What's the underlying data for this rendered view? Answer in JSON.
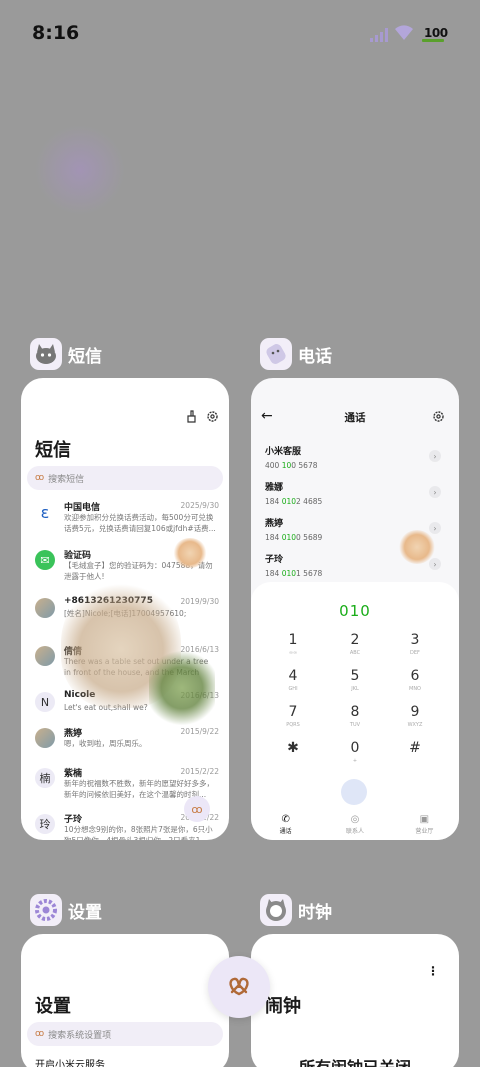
{
  "status_bar": {
    "time": "8:16",
    "battery": "100"
  },
  "apps": [
    {
      "title": "短信",
      "icon": "cat-icon"
    },
    {
      "title": "电话",
      "icon": "bandage-cat-icon"
    },
    {
      "title": "设置",
      "icon": "settings-flower-icon"
    },
    {
      "title": "时钟",
      "icon": "clock-cat-icon"
    }
  ],
  "sms": {
    "title": "短信",
    "search_placeholder": "搜索短信",
    "messages": [
      {
        "name": "中国电信",
        "date": "2025/9/30",
        "avatar": "telecom-icon",
        "body": "欢迎参加积分兑换话费活动，每500分可兑换话费5元，兑换话费请回复106或jfdh#话费..."
      },
      {
        "name": "验证码",
        "date": "",
        "avatar": "message-icon",
        "body": "【毛绒盒子】您的验证码为：047588，请勿泄露于他人!"
      },
      {
        "name": "+8613261230775",
        "date": "2019/9/30",
        "avatar": "photo-avatar",
        "body": "[姓名]Nicole;[电话]17004957610;"
      },
      {
        "name": "倩倩",
        "date": "2016/6/13",
        "avatar": "photo-avatar",
        "body": "There was a table set out under a tree in front of the house, and the March Hare an..."
      },
      {
        "name": "Nicole",
        "date": "2016/6/13",
        "avatar": "N",
        "body": "Let's eat out,shall we?"
      },
      {
        "name": "燕婷",
        "date": "2015/9/22",
        "avatar": "photo-avatar",
        "body": "嗯，收到啦，周乐周乐。"
      },
      {
        "name": "紫楠",
        "date": "2015/2/22",
        "avatar": "楠",
        "body": "新年的祝福数不胜数，新年的愿望好好多多，新年的问候依旧美好，在这个温馨的时刻..."
      },
      {
        "name": "子玲",
        "date": "2015/2/22",
        "avatar": "玲",
        "body": "10分想念9别的你，8张照片7张是你，6只小狗5只像你，4根骨头3根归你，2只看来1..."
      }
    ]
  },
  "phone": {
    "header": "通话",
    "contacts": [
      {
        "name": "小米客服",
        "pre": "400 ",
        "hl": "10",
        "post": "0 5678"
      },
      {
        "name": "雅娜",
        "pre": "184 ",
        "hl": "010",
        "post": "2 4685"
      },
      {
        "name": "燕婷",
        "pre": "184 ",
        "hl": "010",
        "post": "0 5689"
      },
      {
        "name": "子玲",
        "pre": "184 ",
        "hl": "010",
        "post": "1 5678"
      }
    ],
    "dial_input": "010",
    "keys": [
      {
        "d": "1",
        "l": "∞∞"
      },
      {
        "d": "2",
        "l": "ABC"
      },
      {
        "d": "3",
        "l": "DEF"
      },
      {
        "d": "4",
        "l": "GHI"
      },
      {
        "d": "5",
        "l": "JKL"
      },
      {
        "d": "6",
        "l": "MNO"
      },
      {
        "d": "7",
        "l": "PQRS"
      },
      {
        "d": "8",
        "l": "TUV"
      },
      {
        "d": "9",
        "l": "WXYZ"
      },
      {
        "d": "✱",
        "l": ""
      },
      {
        "d": "0",
        "l": "+"
      },
      {
        "d": "#",
        "l": ""
      }
    ],
    "tabs": [
      "通话",
      "联系人",
      "营业厅"
    ]
  },
  "settings": {
    "title": "设置",
    "search_placeholder": "搜索系统设置项",
    "row": "开启小米云服务"
  },
  "clock": {
    "title": "闹钟",
    "status": "所有闹钟已关闭"
  },
  "colors": {
    "accent_green": "#1aad19",
    "card_bg": "#ffffff",
    "search_bg": "#f1eef7"
  }
}
